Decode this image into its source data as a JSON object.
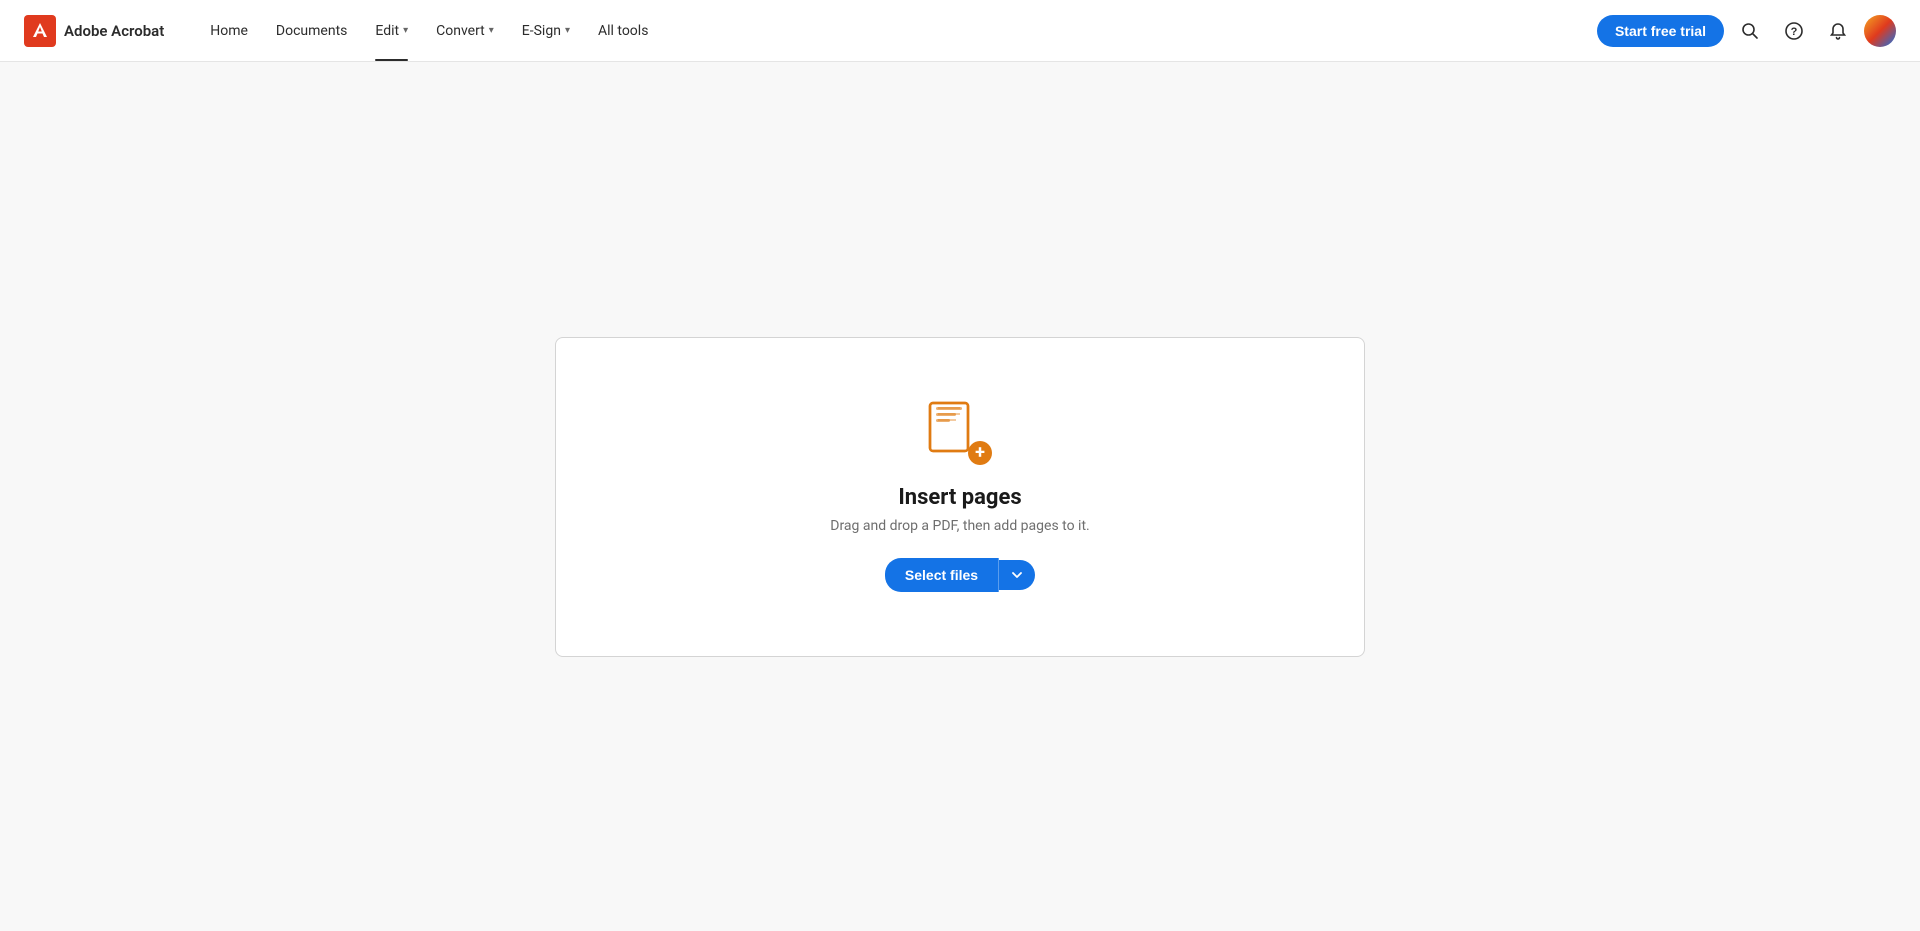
{
  "app": {
    "logo_text": "Adobe Acrobat",
    "logo_color": "#e03a1e"
  },
  "nav": {
    "items": [
      {
        "id": "home",
        "label": "Home",
        "active": false,
        "has_dropdown": false
      },
      {
        "id": "documents",
        "label": "Documents",
        "active": false,
        "has_dropdown": false
      },
      {
        "id": "edit",
        "label": "Edit",
        "active": true,
        "has_dropdown": true
      },
      {
        "id": "convert",
        "label": "Convert",
        "active": false,
        "has_dropdown": true
      },
      {
        "id": "esign",
        "label": "E-Sign",
        "active": false,
        "has_dropdown": true
      },
      {
        "id": "all-tools",
        "label": "All tools",
        "active": false,
        "has_dropdown": false
      }
    ]
  },
  "header": {
    "trial_button": "Start free trial"
  },
  "main": {
    "title": "Insert pages",
    "subtitle": "Drag and drop a PDF, then add pages to it.",
    "select_files_label": "Select files"
  },
  "icons": {
    "search": "🔍",
    "help": "?",
    "bell": "🔔",
    "chevron_down": "▾",
    "plus": "+"
  }
}
